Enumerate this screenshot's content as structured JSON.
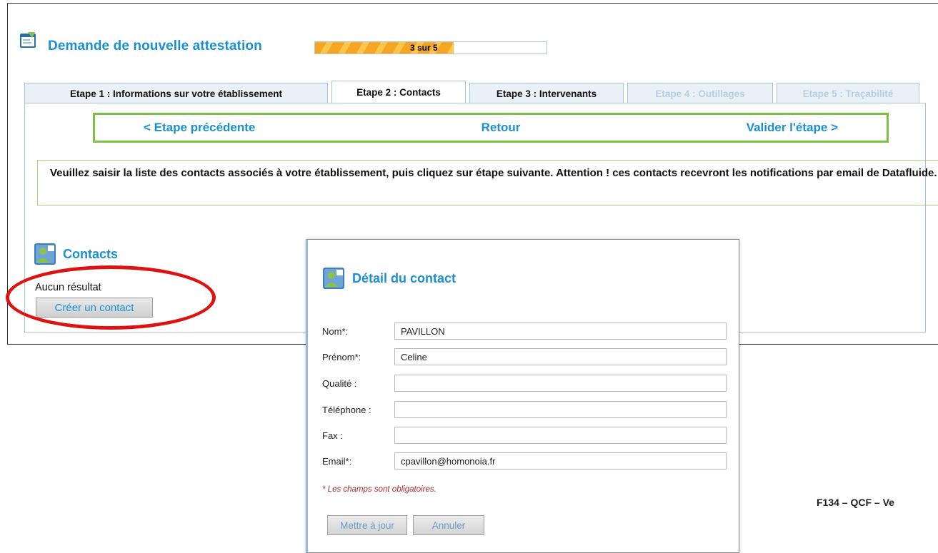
{
  "header": {
    "title": "Demande de nouvelle attestation",
    "progress_text": "3 sur 5",
    "progress_fraction": 0.6
  },
  "tabs": [
    {
      "label": "Etape 1 : Informations sur votre établissement",
      "state": "normal"
    },
    {
      "label": "Etape 2 : Contacts",
      "state": "active"
    },
    {
      "label": "Etape 3 : Intervenants",
      "state": "normal"
    },
    {
      "label": "Etape 4 : Outillages",
      "state": "disabled"
    },
    {
      "label": "Etape 5 : Traçabilité",
      "state": "disabled"
    }
  ],
  "nav": {
    "prev": "< Etape précédente",
    "back": "Retour",
    "next": "Valider l'étape >"
  },
  "notice": "Veuillez saisir la liste des contacts associés à votre établissement, puis cliquez sur étape suivante. Attention ! ces contacts recevront les notifications par email de Datafluide.",
  "contacts": {
    "title": "Contacts",
    "empty_text": "Aucun résultat",
    "create_button": "Créer un contact"
  },
  "modal": {
    "title": "Détail du contact",
    "fields": [
      {
        "label": "Nom*:",
        "value": "PAVILLON"
      },
      {
        "label": "Prénom*:",
        "value": "Celine"
      },
      {
        "label": "Qualité :",
        "value": ""
      },
      {
        "label": "Téléphone :",
        "value": ""
      },
      {
        "label": "Fax :",
        "value": ""
      },
      {
        "label": "Email*:",
        "value": "cpavillon@homonoia.fr"
      }
    ],
    "required_note": "* Les champs sont obligatoires.",
    "update_button": "Mettre à jour",
    "cancel_button": "Annuler"
  },
  "footer_code": "F134 – QCF – Ve",
  "colors": {
    "accent_blue": "#1c8fd1",
    "nav_border_green": "#7cc242",
    "annotation_red": "#e01111",
    "progress_orange": "#f5a623"
  }
}
